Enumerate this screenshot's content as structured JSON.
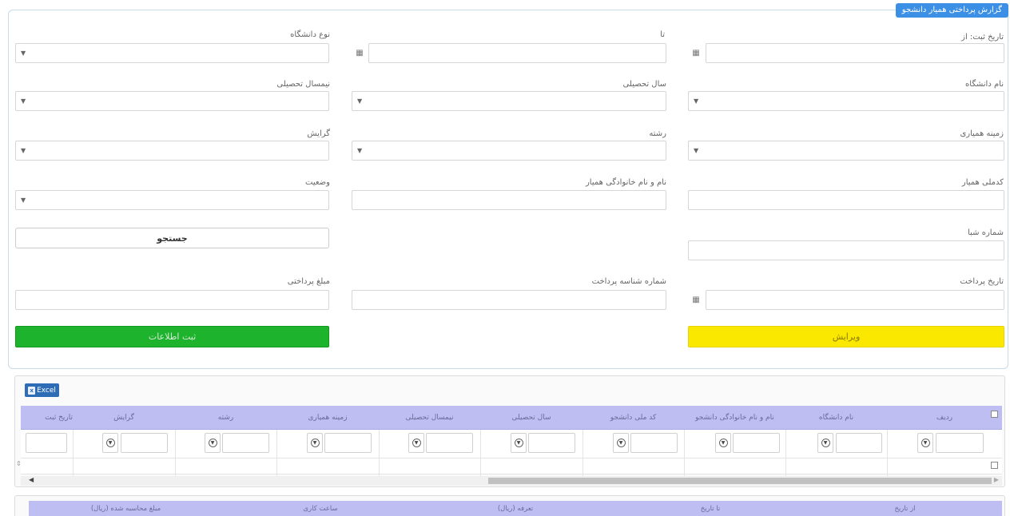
{
  "panel_title": "گزارش پرداختی همیار دانشجو",
  "form": {
    "registration_date_from": {
      "label": "تاریخ ثبت: از",
      "value": ""
    },
    "to": {
      "label": "تا",
      "value": ""
    },
    "university_type": {
      "label": "نوع دانشگاه",
      "value": ""
    },
    "university_name": {
      "label": "نام دانشگاه",
      "value": ""
    },
    "academic_year": {
      "label": "سال تحصیلی",
      "value": ""
    },
    "semester": {
      "label": "نیمسال تحصیلی",
      "value": ""
    },
    "cooperation_field": {
      "label": "زمینه همیاری",
      "value": ""
    },
    "major": {
      "label": "رشته",
      "value": ""
    },
    "orientation": {
      "label": "گرایش",
      "value": ""
    },
    "assistant_national_code": {
      "label": "کدملی همیار",
      "value": ""
    },
    "assistant_full_name": {
      "label": "نام و نام خانوادگی همیار",
      "value": ""
    },
    "status": {
      "label": "وضعیت",
      "value": ""
    },
    "sheba_number": {
      "label": "شماره شبا",
      "value": ""
    },
    "payment_date": {
      "label": "تاریخ پرداخت",
      "value": ""
    },
    "payment_id": {
      "label": "شماره شناسه پرداخت",
      "value": ""
    },
    "payment_amount": {
      "label": "مبلغ پرداختی",
      "value": ""
    }
  },
  "buttons": {
    "search": "جستجو",
    "submit": "ثبت اطلاعات",
    "edit": "ویرایش",
    "excel": "Excel"
  },
  "grid": {
    "columns": [
      "ردیف",
      "نام دانشگاه",
      "نام و نام خانوادگی دانشجو",
      "کد ملی دانشجو",
      "سال تحصیلی",
      "نیمسال تحصیلی",
      "زمینه همیاری",
      "رشته",
      "گرایش",
      "تاریخ ثبت"
    ]
  },
  "grid2": {
    "columns": [
      "از تاریخ",
      "تا تاریخ",
      "تعرفه (ریال)",
      "ساعت کاری",
      "مبلغ محاسبه شده (ریال)"
    ]
  },
  "colors": {
    "title_bg": "#3b8fe4",
    "submit_bg": "#1db32d",
    "edit_bg": "#fae800",
    "grid_header_bg": "#bebef3"
  }
}
